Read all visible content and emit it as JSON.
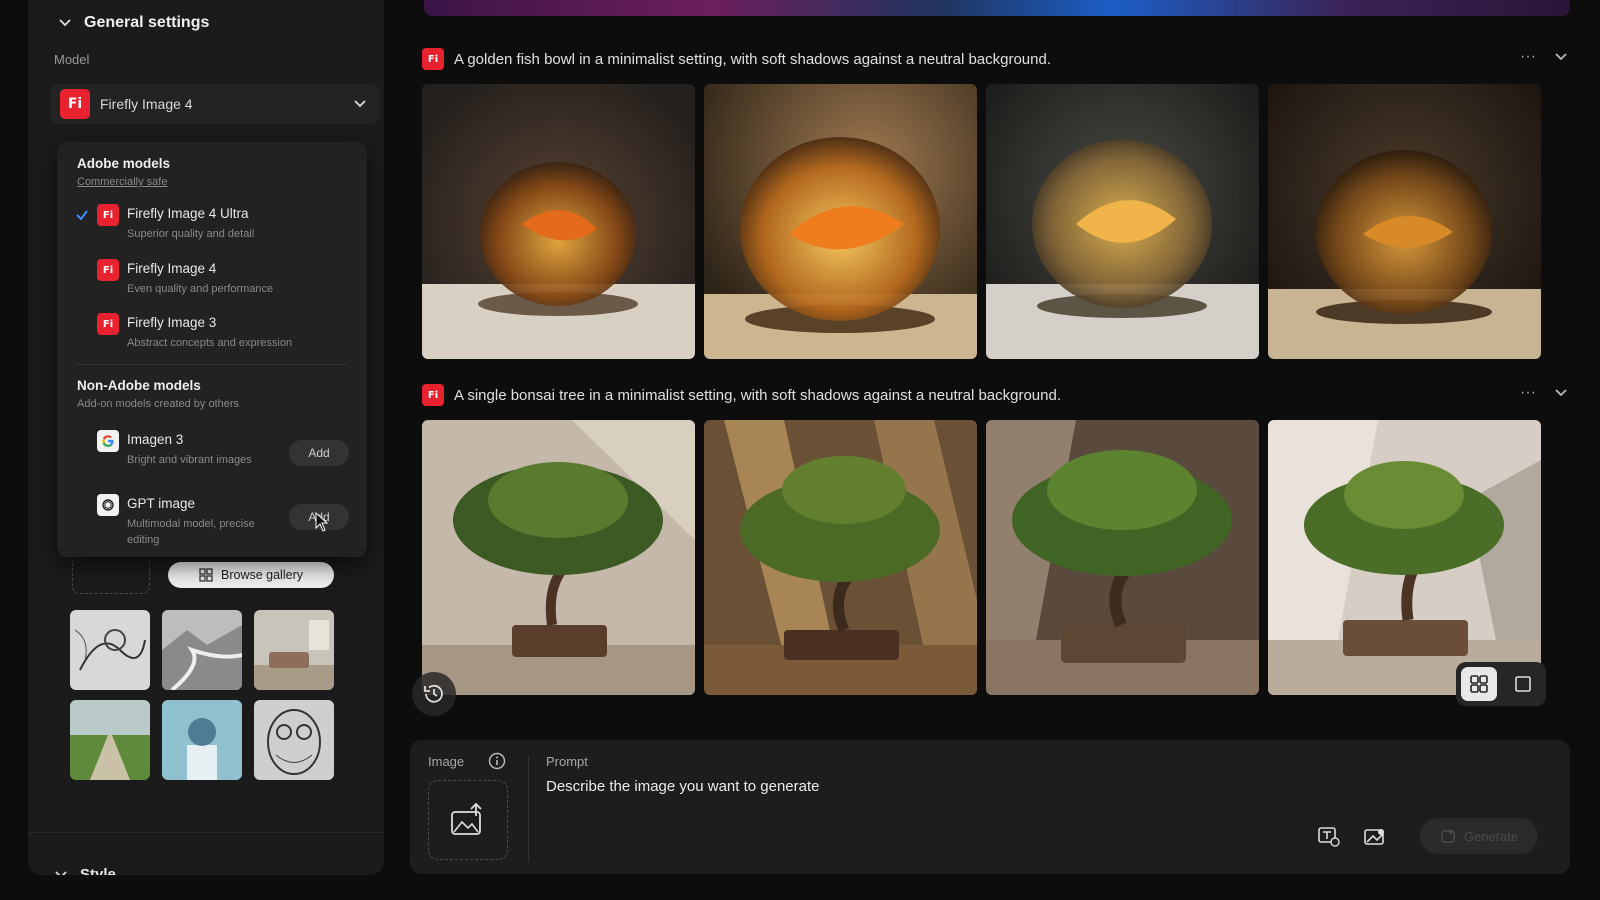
{
  "general_settings": {
    "title": "General settings",
    "model_label": "Model",
    "selected_model": "Firefly Image 4",
    "badge": "Fi"
  },
  "model_dropdown": {
    "adobe_group": {
      "title": "Adobe models",
      "subtitle": "Commercially safe",
      "items": [
        {
          "name": "Firefly Image 4 Ultra",
          "desc": "Superior quality and detail",
          "checked": true
        },
        {
          "name": "Firefly Image 4",
          "desc": "Even quality and performance",
          "checked": false
        },
        {
          "name": "Firefly Image 3",
          "desc": "Abstract concepts and expression",
          "checked": false
        }
      ]
    },
    "non_adobe_group": {
      "title": "Non-Adobe models",
      "subtitle": "Add-on models created by others",
      "items": [
        {
          "name": "Imagen 3",
          "desc": "Bright and vibrant images",
          "button": "Add",
          "icon": "google-icon"
        },
        {
          "name": "GPT image",
          "desc": "Multimodal model, precise editing",
          "button": "Add",
          "icon": "openai-icon"
        }
      ]
    }
  },
  "style_reference": {
    "browse_label": "Browse gallery",
    "thumbnails": [
      "sketch-bird",
      "ink-landscape",
      "interior-room",
      "green-field",
      "sphere-pedestal",
      "owl-pattern"
    ]
  },
  "style_section": {
    "title": "Style"
  },
  "generations": [
    {
      "badge": "Fi",
      "prompt": "A golden fish bowl in a minimalist setting, with soft shadows against a neutral background.",
      "images": 4
    },
    {
      "badge": "Fi",
      "prompt": "A single bonsai tree in a minimalist setting, with soft shadows against a neutral background.",
      "images": 4
    }
  ],
  "row_actions": {
    "more": "···",
    "collapse": "⌄"
  },
  "prompt_bar": {
    "image_label": "Image",
    "prompt_label": "Prompt",
    "prompt_placeholder": "Describe the image you want to generate",
    "generate_label": "Generate"
  },
  "colors": {
    "accent_red": "#e8232f",
    "panel": "#1b1b1b",
    "background": "#0d0d0d"
  }
}
